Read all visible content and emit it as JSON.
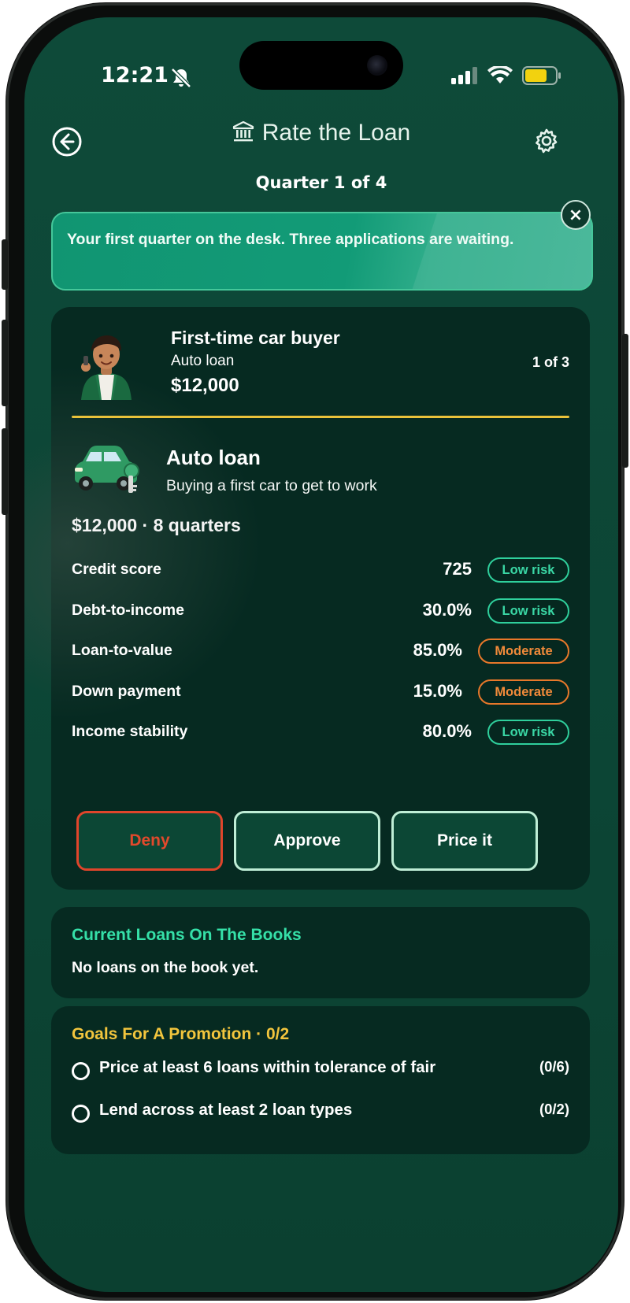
{
  "status_bar": {
    "time": "12:21"
  },
  "header": {
    "title": "Rate the Loan",
    "subtitle": "Quarter 1 of 4"
  },
  "banner": {
    "text": "Your first quarter on the desk. Three applications are waiting.",
    "close_label": "×"
  },
  "application": {
    "borrower_name": "First-time car buyer",
    "loan_type": "Auto loan",
    "amount": "$12,000",
    "counter": "1 of 3",
    "loan_title": "Auto loan",
    "loan_description": "Buying a first car to get to work",
    "summary": "$12,000 · 8 quarters",
    "metrics": [
      {
        "label": "Credit score",
        "value": "725",
        "risk": "Low risk"
      },
      {
        "label": "Debt-to-income",
        "value": "30.0%",
        "risk": "Low risk"
      },
      {
        "label": "Loan-to-value",
        "value": "85.0%",
        "risk": "Moderate"
      },
      {
        "label": "Down payment",
        "value": "15.0%",
        "risk": "Moderate"
      },
      {
        "label": "Income stability",
        "value": "80.0%",
        "risk": "Low risk"
      }
    ],
    "actions": {
      "deny": "Deny",
      "approve": "Approve",
      "price": "Price it"
    }
  },
  "current_loans": {
    "title": "Current Loans On The Books",
    "empty_text": "No loans on the book yet."
  },
  "goals": {
    "title": "Goals For A Promotion · 0/2",
    "items": [
      {
        "text": "Price at least 6 loans within tolerance of fair",
        "count": "(0/6)"
      },
      {
        "text": "Lend across at least 2 loan types",
        "count": "(0/2)"
      }
    ]
  },
  "colors": {
    "background": "#0c4535",
    "card": "#062a21",
    "banner": "#129b77",
    "accent_green": "#3ad7a5",
    "accent_yellow": "#f2c53d",
    "moderate_orange": "#f08a3a",
    "deny_red": "#e0452b"
  },
  "icons": [
    "back-arrow-icon",
    "bank-icon",
    "gear-icon",
    "bell-slash-icon",
    "signal-icon",
    "wifi-icon",
    "battery-icon",
    "close-icon",
    "radio-circle-icon"
  ]
}
